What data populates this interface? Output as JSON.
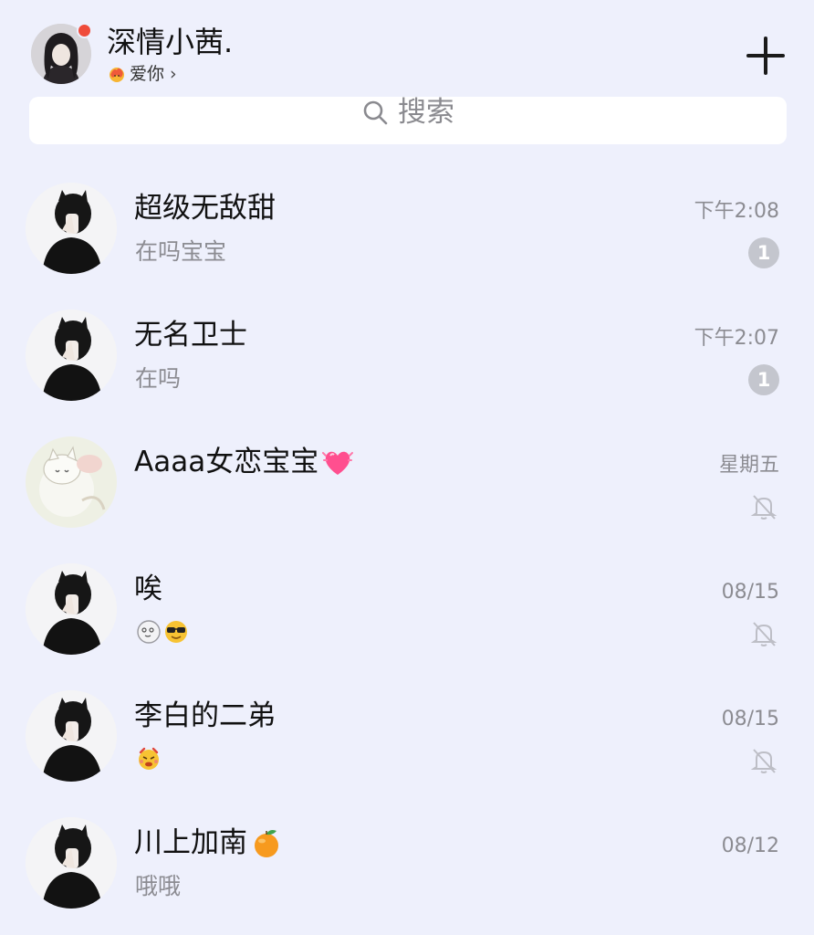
{
  "header": {
    "profile_name": "深情小茜.",
    "status_text": "爱你",
    "status_chevron": "›",
    "status_icon": "fire-emoji",
    "online_dot_color": "#ef4b3a",
    "add_icon": "plus-icon"
  },
  "search": {
    "placeholder": "搜索",
    "icon": "search-icon"
  },
  "chats": [
    {
      "name": "超级无敌甜",
      "preview": "在吗宝宝",
      "time": "下午2:08",
      "unread": "1",
      "muted": false
    },
    {
      "name": "无名卫士",
      "preview": "在吗",
      "time": "下午2:07",
      "unread": "1",
      "muted": false
    },
    {
      "name": "Aaaa女恋宝宝",
      "name_emoji": "pink-heart-emoji",
      "preview": "",
      "time": "星期五",
      "muted": true
    },
    {
      "name": "唉",
      "preview": "",
      "preview_emojis": [
        "cat-face-sticker",
        "sunglasses-emoji"
      ],
      "time": "08/15",
      "muted": true
    },
    {
      "name": "李白的二弟",
      "preview": "",
      "preview_emojis": [
        "angry-emoji"
      ],
      "time": "08/15",
      "muted": true
    },
    {
      "name": "川上加南",
      "name_emoji": "tangerine-emoji",
      "preview": "哦哦",
      "time": "08/12",
      "muted": false
    }
  ],
  "colors": {
    "background": "#eef0fc",
    "badge": "#c4c6ce",
    "secondary_text": "#8c8c92"
  }
}
